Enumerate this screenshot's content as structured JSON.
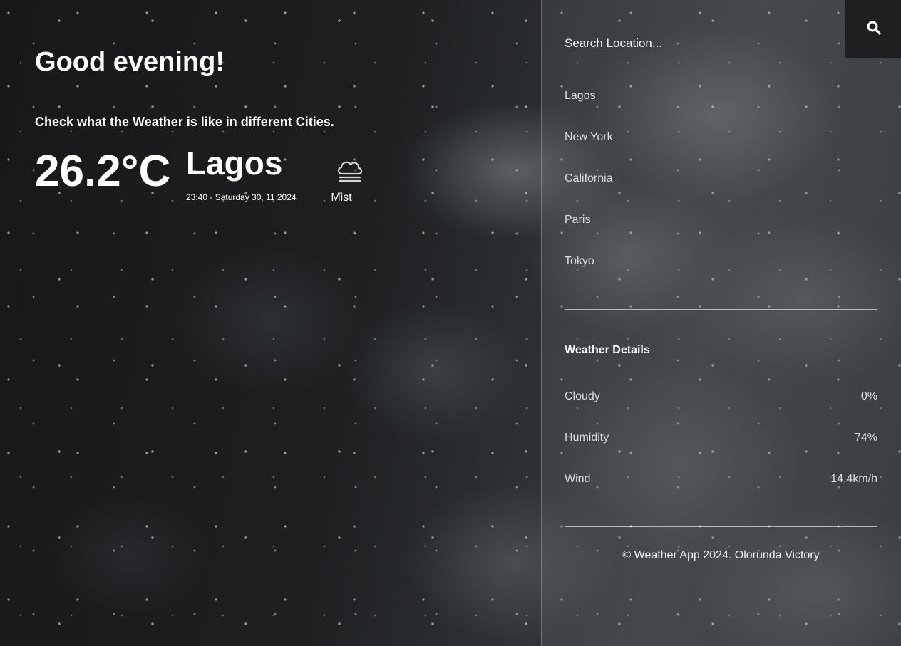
{
  "main": {
    "greeting": "Good evening!",
    "subtitle": "Check what the Weather is like in different Cities.",
    "temperature": "26.2°C",
    "city": "Lagos",
    "datetime": "23:40 - Saturday 30, 11 2024",
    "condition": "Mist",
    "condition_icon": "cloud-mist-icon"
  },
  "search": {
    "placeholder": "Search Location...",
    "button_icon": "search-icon"
  },
  "cities": [
    "Lagos",
    "New York",
    "California",
    "Paris",
    "Tokyo"
  ],
  "details": {
    "title": "Weather Details",
    "rows": [
      {
        "label": "Cloudy",
        "value": "0%"
      },
      {
        "label": "Humidity",
        "value": "74%"
      },
      {
        "label": "Wind",
        "value": "14.4km/h"
      }
    ]
  },
  "footer": "© Weather App 2024. Olorunda Victory",
  "colors": {
    "panel": "#6e7378",
    "search_button": "#1e1f20",
    "text": "#ffffff"
  }
}
